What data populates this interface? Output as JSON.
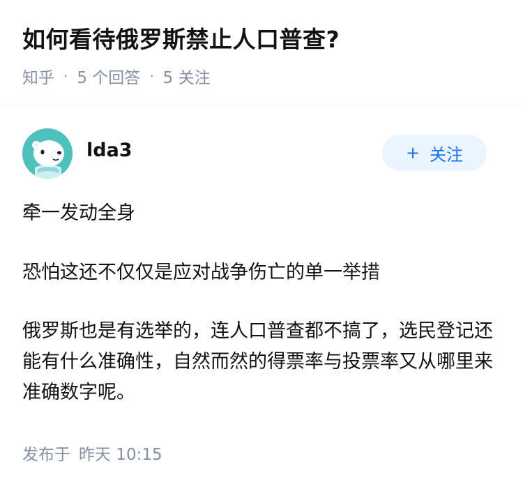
{
  "question": {
    "title": "如何看待俄罗斯禁止人口普查?",
    "source": "知乎",
    "answer_count": "5 个回答",
    "follower_count": "5 关注",
    "separator": "·"
  },
  "answer": {
    "author": "lda3",
    "follow_label": "关注",
    "follow_plus": "+",
    "paragraphs": [
      "牵一发动全身",
      "恐怕这还不仅仅是应对战争伤亡的单一举措",
      "俄罗斯也是有选举的，连人口普查都不搞了，选民登记还能有什么准确性，自然而然的得票率与投票率又从哪里来准确数字呢。"
    ],
    "published_prefix": "发布于",
    "published_time": "昨天 10:15"
  },
  "colors": {
    "meta_gray": "#8590a6",
    "brand_blue": "#1772f6",
    "follow_bg": "#ebf5ff",
    "avatar_teal": "#4fc1bd"
  },
  "icons": {
    "avatar": "polar-bear-avatar"
  }
}
